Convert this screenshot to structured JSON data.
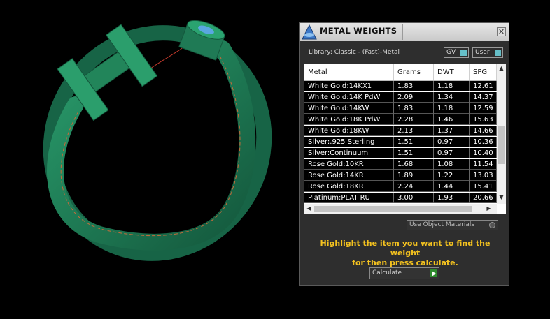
{
  "panel": {
    "title": "METAL WEIGHTS",
    "close_glyph": "✕",
    "library_label": "Library: Classic - (Fast)-Metal",
    "toggles": {
      "gv": "GV",
      "user": "User"
    },
    "use_materials_label": "Use Object Materials",
    "message_line1": "Highlight the item you want to find the weight",
    "message_line2": "for then press calculate.",
    "calculate_label": "Calculate"
  },
  "table": {
    "headers": [
      "Metal",
      "Grams",
      "DWT",
      "SPG"
    ],
    "rows": [
      [
        "White Gold:14KX1",
        "1.83",
        "1.18",
        "12.61"
      ],
      [
        "White Gold:14K PdW",
        "2.09",
        "1.34",
        "14.37"
      ],
      [
        "White Gold:14KW",
        "1.83",
        "1.18",
        "12.59"
      ],
      [
        "White Gold:18K PdW",
        "2.28",
        "1.46",
        "15.63"
      ],
      [
        "White Gold:18KW",
        "2.13",
        "1.37",
        "14.66"
      ],
      [
        "Silver:.925 Sterling",
        "1.51",
        "0.97",
        "10.36"
      ],
      [
        "Silver:Continuum",
        "1.51",
        "0.97",
        "10.40"
      ],
      [
        "Rose Gold:10KR",
        "1.68",
        "1.08",
        "11.54"
      ],
      [
        "Rose Gold:14KR",
        "1.89",
        "1.22",
        "13.03"
      ],
      [
        "Rose Gold:18KR",
        "2.24",
        "1.44",
        "15.41"
      ],
      [
        "Platinum:PLAT RU",
        "3.00",
        "1.93",
        "20.66"
      ]
    ]
  },
  "colors": {
    "ring": "#1f7a55",
    "accent_teal": "#66bfc8",
    "message": "#f4c21f",
    "calc_go": "#2e8b2e"
  },
  "icons": {
    "app_logo": "metal-weights-logo-icon",
    "close": "close-icon",
    "scroll_up": "scroll-up-arrow-icon",
    "scroll_down": "scroll-down-arrow-icon",
    "scroll_left": "scroll-left-arrow-icon",
    "scroll_right": "scroll-right-arrow-icon",
    "calculate": "play-arrow-icon"
  }
}
